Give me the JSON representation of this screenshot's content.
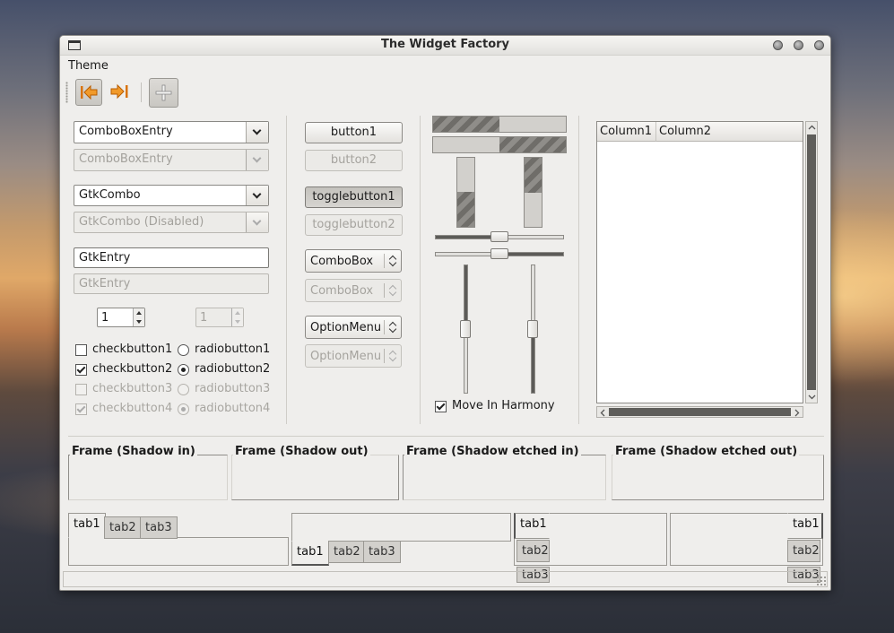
{
  "window": {
    "title": "The Widget Factory"
  },
  "menu": {
    "theme": "Theme"
  },
  "toolbar": {
    "back_icon": "go-back-icon",
    "forward_icon": "go-forward-icon",
    "add_icon": "add-icon"
  },
  "left": {
    "combo_entry_1": "ComboBoxEntry",
    "combo_entry_2": "ComboBoxEntry",
    "gtk_combo_1": "GtkCombo",
    "gtk_combo_2": "GtkCombo (Disabled)",
    "entry_1": "GtkEntry",
    "entry_2": "GtkEntry",
    "spin_1": "1",
    "spin_2": "1",
    "checks": [
      "checkbutton1",
      "checkbutton2",
      "checkbutton3",
      "checkbutton4"
    ],
    "radios": [
      "radiobutton1",
      "radiobutton2",
      "radiobutton3",
      "radiobutton4"
    ]
  },
  "middle": {
    "button1": "button1",
    "button2": "button2",
    "toggle1": "togglebutton1",
    "toggle2": "togglebutton2",
    "combo1": "ComboBox",
    "combo2": "ComboBox",
    "option1": "OptionMenu",
    "option2": "OptionMenu"
  },
  "sliders": {
    "progress_h1": 0.5,
    "progress_h2": 0.5,
    "progress_v1": 0.5,
    "progress_v2": 0.5,
    "scale_h1": 0.5,
    "scale_h2": 0.5,
    "scale_v1": 0.5,
    "scale_v2": 0.5,
    "move_in_harmony": "Move In Harmony"
  },
  "tree": {
    "columns": [
      "Column1",
      "Column2"
    ]
  },
  "frames": [
    "Frame (Shadow in)",
    "Frame (Shadow out)",
    "Frame (Shadow etched in)",
    "Frame (Shadow etched out)"
  ],
  "tabs": {
    "t1": "tab1",
    "t2": "tab2",
    "t3": "tab3"
  }
}
